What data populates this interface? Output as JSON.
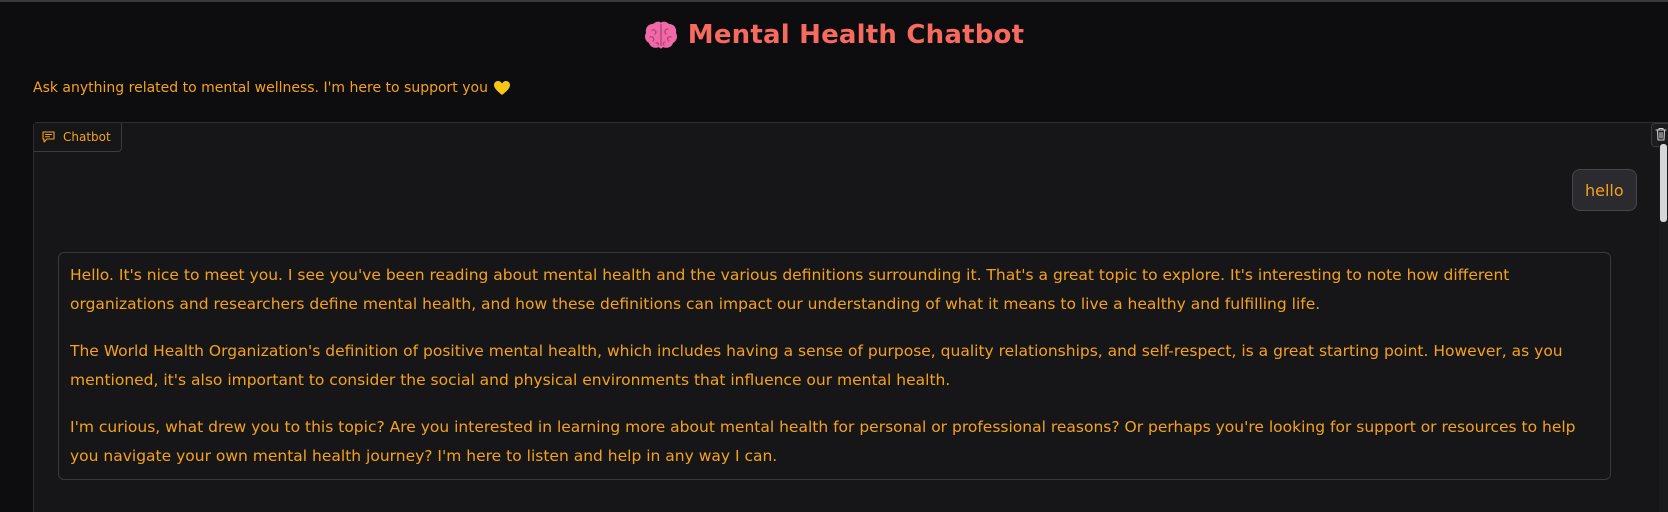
{
  "header": {
    "title": "Mental Health Chatbot",
    "title_icon": "brain-icon",
    "subtitle": "Ask anything related to mental wellness. I'm here to support you",
    "subtitle_icon": "yellow-heart-icon"
  },
  "chatbot": {
    "label": "Chatbot",
    "label_icon": "chat-bubble-icon",
    "clear_icon": "trash-icon",
    "messages": [
      {
        "role": "user",
        "text": "hello"
      },
      {
        "role": "assistant",
        "paragraphs": [
          "Hello. It's nice to meet you. I see you've been reading about mental health and the various definitions surrounding it. That's a great topic to explore. It's interesting to note how different organizations and researchers define mental health, and how these definitions can impact our understanding of what it means to live a healthy and fulfilling life.",
          "The World Health Organization's definition of positive mental health, which includes having a sense of purpose, quality relationships, and self-respect, is a great starting point. However, as you mentioned, it's also important to consider the social and physical environments that influence our mental health.",
          "I'm curious, what drew you to this topic? Are you interested in learning more about mental health for personal or professional reasons? Or perhaps you're looking for support or resources to help you navigate your own mental health journey? I'm here to listen and help in any way I can."
        ]
      }
    ]
  },
  "colors": {
    "background": "#0d0d0f",
    "panel": "#161618",
    "accent_text": "#f4a21d",
    "title": "#f76a5f",
    "border": "#38383e"
  }
}
